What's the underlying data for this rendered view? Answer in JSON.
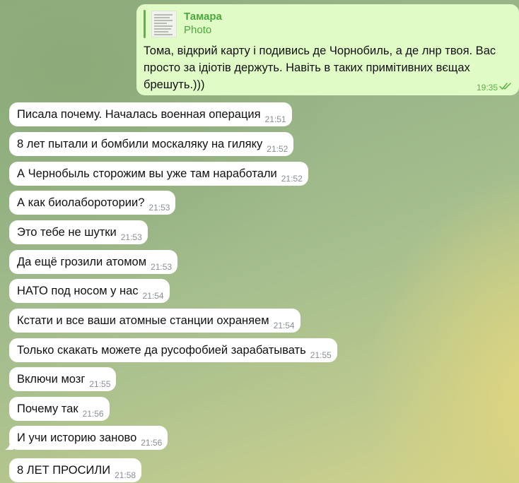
{
  "outgoing": {
    "reply_name": "Тамара",
    "reply_type": "Photo",
    "text": "Тома, відкрий карту і подивись де Чорнобиль, а де лнр твоя. Вас просто за ідіотів держуть. Навіть в таких примітивних вєщах брешуть.)))",
    "time": "19:35",
    "status": "double-check-icon"
  },
  "incoming": [
    {
      "text": "Писала почему. Началась военная операция",
      "time": "21:51"
    },
    {
      "text": "8 лет пытали и бомбили москаляку на гиляку",
      "time": "21:52"
    },
    {
      "text": "А Чернобыль сторожим вы уже там наработали",
      "time": "21:52"
    },
    {
      "text": "А как биолаборотории?",
      "time": "21:53"
    },
    {
      "text": "Это тебе не шутки",
      "time": "21:53"
    },
    {
      "text": "Да ещё грозили атомом",
      "time": "21:53"
    },
    {
      "text": "НАТО под носом у нас",
      "time": "21:54"
    },
    {
      "text": "Кстати и все ваши атомные станции  охраняем",
      "time": "21:54"
    },
    {
      "text": "Только скакать можете да русофобией зарабатывать",
      "time": "21:55"
    },
    {
      "text": "Включи мозг",
      "time": "21:55"
    },
    {
      "text": "Почему так",
      "time": "21:56"
    },
    {
      "text": "И учи историю заново",
      "time": "21:56"
    },
    {
      "text": "8 ЛЕТ ПРОСИЛИ",
      "time": "21:58"
    }
  ],
  "colors": {
    "outgoing_bubble": "#e1fbc6",
    "incoming_bubble": "#ffffff",
    "accent_green": "#4aa93d"
  }
}
